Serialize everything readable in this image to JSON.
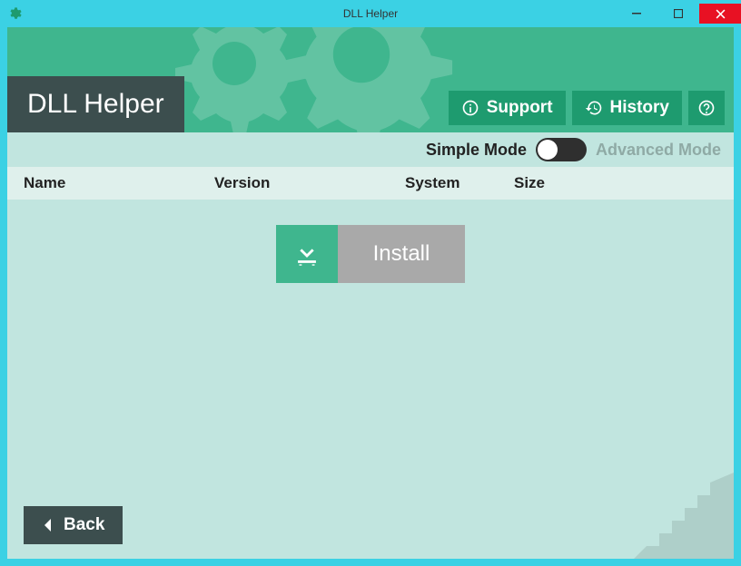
{
  "window": {
    "title": "DLL Helper"
  },
  "header": {
    "app_title": "DLL Helper",
    "support_label": "Support",
    "history_label": "History"
  },
  "mode": {
    "simple_label": "Simple Mode",
    "advanced_label": "Advanced Mode",
    "active": "simple"
  },
  "columns": {
    "name": "Name",
    "version": "Version",
    "system": "System",
    "size": "Size"
  },
  "actions": {
    "install_label": "Install",
    "back_label": "Back"
  },
  "colors": {
    "title_bar": "#3bd1e4",
    "header_bg": "#3fb68e",
    "dark_box": "#3c4e4e",
    "content_bg": "#c1e5df",
    "close_red": "#e81123"
  }
}
